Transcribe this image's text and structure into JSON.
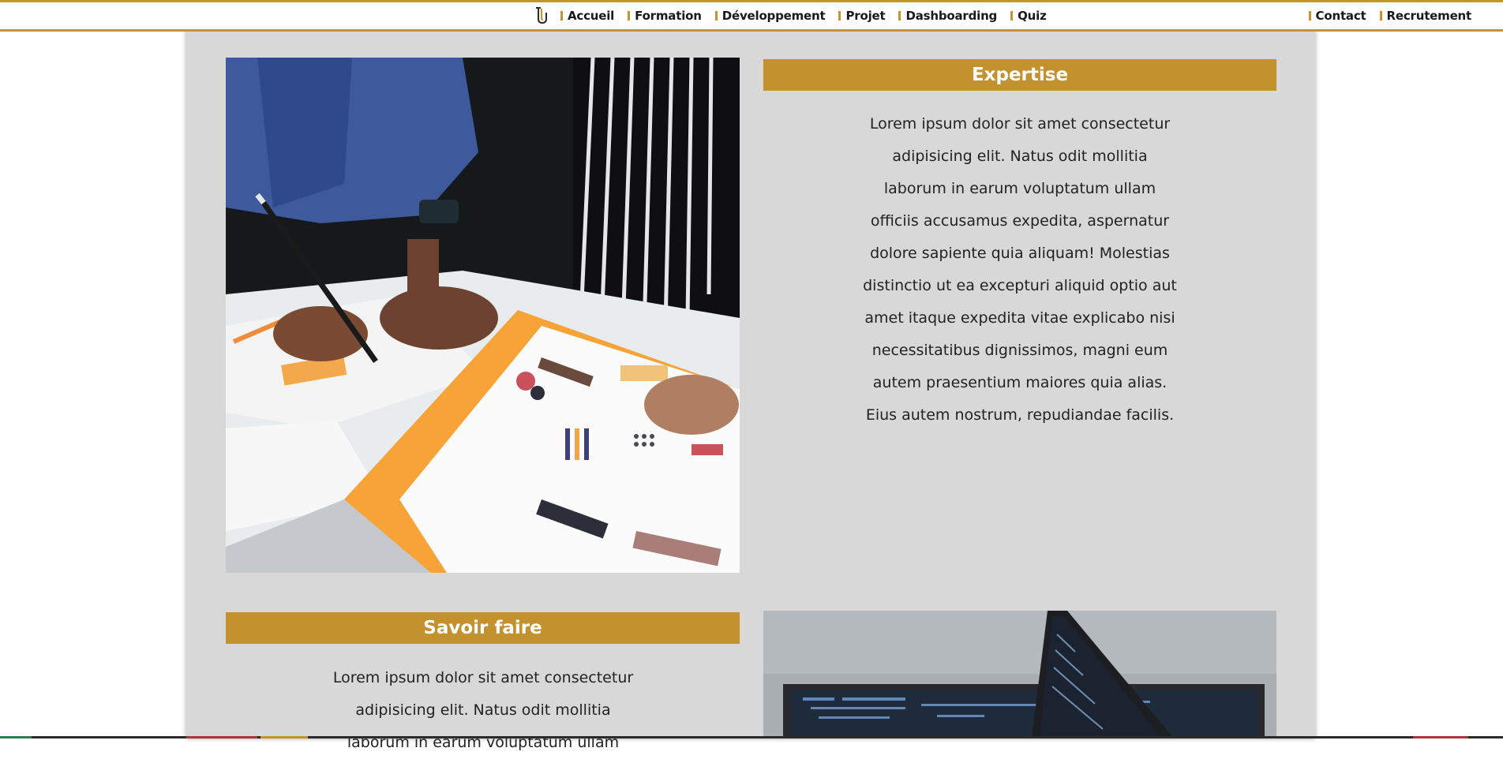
{
  "nav": {
    "logo_icon": "logo-icon",
    "left_items": [
      {
        "label": "Accueil"
      },
      {
        "label": "Formation"
      },
      {
        "label": "Développement"
      },
      {
        "label": "Projet"
      },
      {
        "label": "Dashboarding"
      },
      {
        "label": "Quiz"
      }
    ],
    "right_items": [
      {
        "label": "Contact"
      },
      {
        "label": "Recrutement"
      }
    ]
  },
  "colors": {
    "accent": "#c3912e",
    "panel_bg": "#d8d8d8",
    "text": "#222222"
  },
  "sections": {
    "expertise": {
      "title": "Expertise",
      "text": "Lorem ipsum dolor sit amet consectetur adipisicing elit. Natus odit mollitia laborum in earum voluptatum ullam officiis accusamus expedita, aspernatur dolore sapiente quia aliquam! Molestias distinctio ut ea excepturi aliquid optio aut amet itaque expedita vitae explicabo nisi necessitatibus dignissimos, magni eum autem praesentium maiores quia alias. Eius autem nostrum, repudiandae facilis.",
      "image": "infographic-desk-photo"
    },
    "savoir_faire": {
      "title": "Savoir faire",
      "text": "Lorem ipsum dolor sit amet consectetur adipisicing elit. Natus odit mollitia laborum in earum voluptatum ullam",
      "image": "laptop-code-photo"
    }
  }
}
